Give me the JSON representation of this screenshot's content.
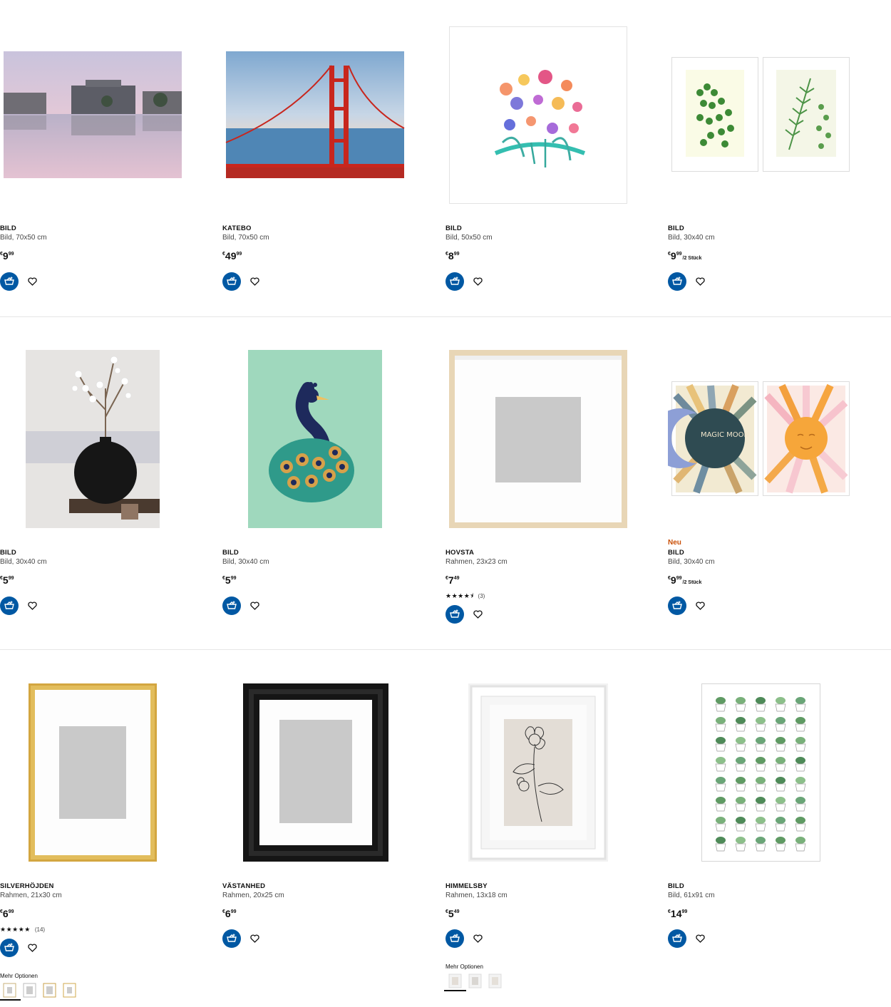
{
  "products": [
    {
      "id": "p1",
      "name": "BILD",
      "desc": "Bild, 70x50 cm",
      "price_int": "9",
      "price_dec": "99",
      "currency": "€",
      "unit": "",
      "badge": "",
      "rating": "",
      "rating_count": ""
    },
    {
      "id": "p2",
      "name": "KATEBO",
      "desc": "Bild, 70x50 cm",
      "price_int": "49",
      "price_dec": "99",
      "currency": "€",
      "unit": "",
      "badge": "",
      "rating": "",
      "rating_count": ""
    },
    {
      "id": "p3",
      "name": "BILD",
      "desc": "Bild, 50x50 cm",
      "price_int": "8",
      "price_dec": "99",
      "currency": "€",
      "unit": "",
      "badge": "",
      "rating": "",
      "rating_count": ""
    },
    {
      "id": "p4",
      "name": "BILD",
      "desc": "Bild, 30x40 cm",
      "price_int": "9",
      "price_dec": "99",
      "currency": "€",
      "unit": "/2 Stück",
      "badge": "",
      "rating": "",
      "rating_count": ""
    },
    {
      "id": "p5",
      "name": "BILD",
      "desc": "Bild, 30x40 cm",
      "price_int": "5",
      "price_dec": "99",
      "currency": "€",
      "unit": "",
      "badge": "",
      "rating": "",
      "rating_count": ""
    },
    {
      "id": "p6",
      "name": "BILD",
      "desc": "Bild, 30x40 cm",
      "price_int": "5",
      "price_dec": "99",
      "currency": "€",
      "unit": "",
      "badge": "",
      "rating": "",
      "rating_count": ""
    },
    {
      "id": "p7",
      "name": "HOVSTA",
      "desc": "Rahmen, 23x23 cm",
      "price_int": "7",
      "price_dec": "49",
      "currency": "€",
      "unit": "",
      "badge": "",
      "rating": "★★★★⯨",
      "rating_count": "(3)"
    },
    {
      "id": "p8",
      "name": "BILD",
      "desc": "Bild, 30x40 cm",
      "price_int": "9",
      "price_dec": "99",
      "currency": "€",
      "unit": "/2 Stück",
      "badge": "Neu",
      "rating": "",
      "rating_count": ""
    },
    {
      "id": "p9",
      "name": "SILVERHÖJDEN",
      "desc": "Rahmen, 21x30 cm",
      "price_int": "6",
      "price_dec": "99",
      "currency": "€",
      "unit": "",
      "badge": "",
      "rating": "★★★★★",
      "rating_count": "(14)"
    },
    {
      "id": "p10",
      "name": "VÄSTANHED",
      "desc": "Rahmen, 20x25 cm",
      "price_int": "6",
      "price_dec": "99",
      "currency": "€",
      "unit": "",
      "badge": "",
      "rating": "",
      "rating_count": ""
    },
    {
      "id": "p11",
      "name": "HIMMELSBY",
      "desc": "Rahmen, 13x18 cm",
      "price_int": "5",
      "price_dec": "49",
      "currency": "€",
      "unit": "",
      "badge": "",
      "rating": "",
      "rating_count": ""
    },
    {
      "id": "p12",
      "name": "BILD",
      "desc": "Bild, 61x91 cm",
      "price_int": "14",
      "price_dec": "99",
      "currency": "€",
      "unit": "",
      "badge": "",
      "rating": "",
      "rating_count": ""
    }
  ],
  "more_options": {
    "label": "Mehr Optionen"
  },
  "poster_text": {
    "magic_moon": "MAGIC MOON"
  },
  "icons": {
    "cart": "add-to-cart-icon",
    "heart": "heart-icon"
  },
  "colors": {
    "brand_blue": "#0058a3",
    "new_badge": "#ca5008"
  }
}
